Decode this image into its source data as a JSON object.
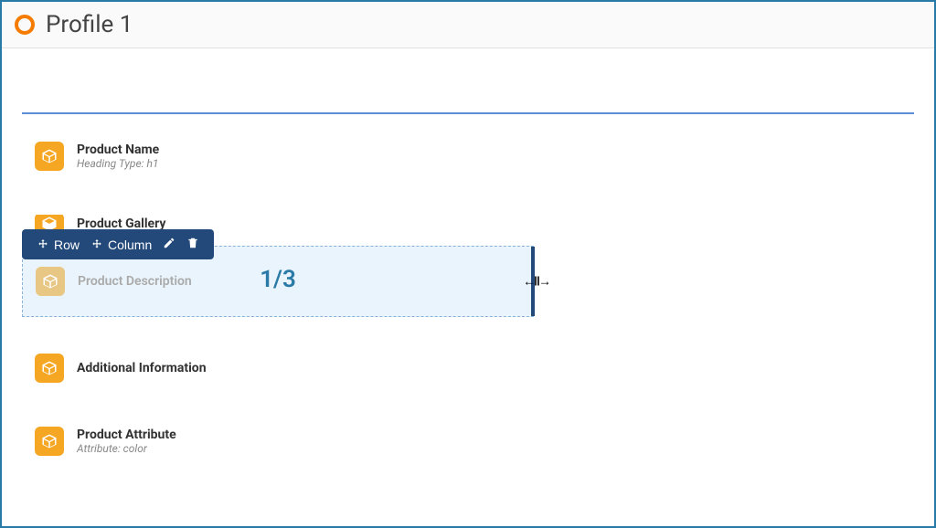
{
  "header": {
    "title": "Profile 1"
  },
  "blocks": {
    "productName": {
      "title": "Product Name",
      "sub": "Heading Type: h1"
    },
    "productGallery": {
      "title": "Product Gallery"
    },
    "productDescription": {
      "title": "Product Description"
    },
    "additionalInfo": {
      "title": "Additional Information"
    },
    "productAttribute": {
      "title": "Product Attribute",
      "sub": "Attribute: color"
    }
  },
  "toolbar": {
    "row": "Row",
    "column": "Column"
  },
  "selection": {
    "fraction": "1/3",
    "resizeGlyph": "↔"
  }
}
